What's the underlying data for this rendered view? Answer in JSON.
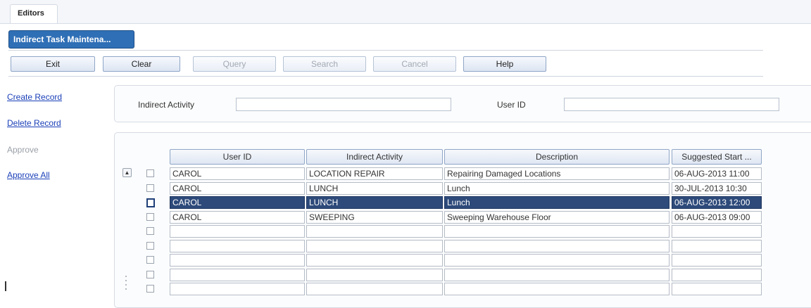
{
  "tabs": {
    "editors": "Editors",
    "task": "Indirect Task Maintena..."
  },
  "toolbar": [
    {
      "label": "Exit",
      "enabled": true
    },
    {
      "label": "Clear",
      "enabled": true
    },
    {
      "label": "Query",
      "enabled": false
    },
    {
      "label": "Search",
      "enabled": false
    },
    {
      "label": "Cancel",
      "enabled": false
    },
    {
      "label": "Help",
      "enabled": true
    }
  ],
  "sidebar": {
    "create": "Create Record",
    "delete": "Delete Record",
    "approve": "Approve",
    "approve_all": "Approve All"
  },
  "query": {
    "activity_label": "Indirect Activity",
    "activity_value": "",
    "user_label": "User ID",
    "user_value": ""
  },
  "grid": {
    "columns": [
      "User ID",
      "Indirect Activity",
      "Description",
      "Suggested Start ..."
    ],
    "rows": [
      {
        "user": "CAROL",
        "activity": "LOCATION REPAIR",
        "description": "Repairing Damaged Locations",
        "start": "06-AUG-2013 11:00"
      },
      {
        "user": "CAROL",
        "activity": "LUNCH",
        "description": "Lunch",
        "start": "30-JUL-2013 10:30"
      },
      {
        "user": "CAROL",
        "activity": "LUNCH",
        "description": "Lunch",
        "start": "06-AUG-2013 12:00"
      },
      {
        "user": "CAROL",
        "activity": "SWEEPING",
        "description": "Sweeping Warehouse Floor",
        "start": "06-AUG-2013 09:00"
      },
      {
        "user": "",
        "activity": "",
        "description": "",
        "start": ""
      },
      {
        "user": "",
        "activity": "",
        "description": "",
        "start": ""
      },
      {
        "user": "",
        "activity": "",
        "description": "",
        "start": ""
      },
      {
        "user": "",
        "activity": "",
        "description": "",
        "start": ""
      },
      {
        "user": "",
        "activity": "",
        "description": "",
        "start": ""
      }
    ],
    "selected_row": 2
  }
}
